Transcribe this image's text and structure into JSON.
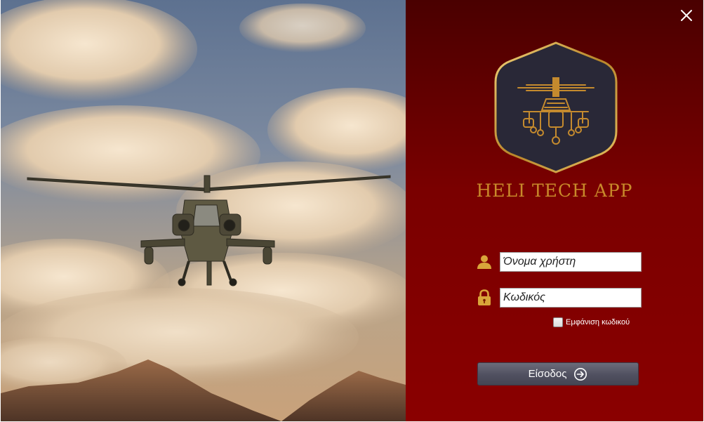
{
  "app": {
    "title": "HELI TECH APP"
  },
  "window": {
    "close_icon": "close-icon"
  },
  "photo": {
    "description_icon": "helicopter-photo"
  },
  "login": {
    "username_placeholder": "Όνομα χρήστη",
    "password_placeholder": "Κωδικός",
    "show_password_label": "Εμφάνιση κωδικού",
    "show_password_checked": false,
    "submit_label": "Είσοδος",
    "user_icon": "user-icon",
    "lock_icon": "lock-icon",
    "submit_icon": "arrow-right-circle-icon"
  },
  "colors": {
    "accent_gold": "#c8892a",
    "panel_dark": "#4a0000",
    "panel_light": "#8a0000",
    "button": "#505060"
  }
}
